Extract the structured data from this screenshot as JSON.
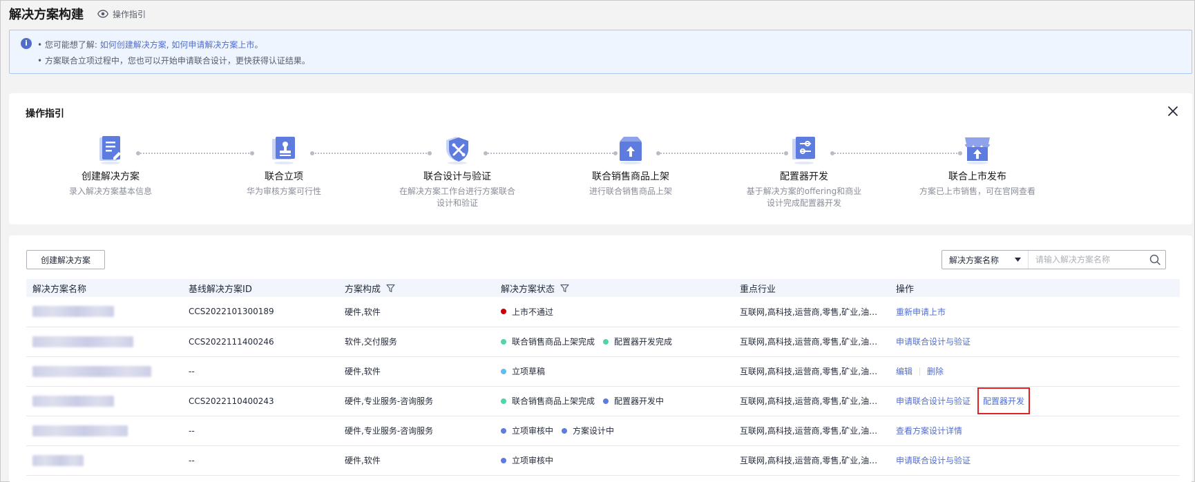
{
  "header": {
    "title": "解决方案构建",
    "guide_link": "操作指引"
  },
  "notice": {
    "line1_prefix": "• 您可能想了解: ",
    "line1_link1": "如何创建解决方案",
    "line1_sep": ", ",
    "line1_link2": "如何申请解决方案上市",
    "line1_suffix": "。",
    "line2": "• 方案联合立项过程中，您也可以开始申请联合设计，更快获得认证结果。"
  },
  "guide": {
    "title": "操作指引",
    "steps": [
      {
        "title": "创建解决方案",
        "desc": "录入解决方案基本信息",
        "icon": "document-edit-icon"
      },
      {
        "title": "联合立项",
        "desc": "华为审核方案可行性",
        "icon": "stamp-icon"
      },
      {
        "title": "联合设计与验证",
        "desc": "在解决方案工作台进行方案联合设计和验证",
        "icon": "shield-tools-icon"
      },
      {
        "title": "联合销售商品上架",
        "desc": "进行联合销售商品上架",
        "icon": "box-upload-icon"
      },
      {
        "title": "配置器开发",
        "desc": "基于解决方案的offering和商业设计完成配置器开发",
        "icon": "config-slider-icon"
      },
      {
        "title": "联合上市发布",
        "desc": "方案已上市销售，可在官网查看",
        "icon": "store-upload-icon"
      }
    ]
  },
  "toolbar": {
    "create_button": "创建解决方案",
    "search_field": "解决方案名称",
    "search_placeholder": "请输入解决方案名称"
  },
  "table": {
    "columns": [
      "解决方案名称",
      "基线解决方案ID",
      "方案构成",
      "解决方案状态",
      "重点行业",
      "操作"
    ],
    "rows": [
      {
        "id": "CCS2022101300189",
        "composition": "硬件,软件",
        "statuses": [
          {
            "label": "上市不通过",
            "color": "#c7000b"
          }
        ],
        "industry": "互联网,高科技,运营商,零售,矿业,油气,智...",
        "actions": [
          "重新申请上市"
        ]
      },
      {
        "id": "CCS2022111400246",
        "composition": "软件,交付服务",
        "statuses": [
          {
            "label": "联合销售商品上架完成",
            "color": "#50d4ab"
          },
          {
            "label": "配置器开发完成",
            "color": "#50d4ab"
          }
        ],
        "industry": "互联网,高科技,运营商,零售,矿业,油气,智...",
        "actions": [
          "申请联合设计与验证"
        ]
      },
      {
        "id": "--",
        "composition": "硬件,软件",
        "statuses": [
          {
            "label": "立项草稿",
            "color": "#62bcf0"
          }
        ],
        "industry": "互联网,高科技,运营商,零售,矿业,油气,智...",
        "actions": [
          "编辑",
          "删除"
        ]
      },
      {
        "id": "CCS2022110400243",
        "composition": "硬件,专业服务-咨询服务",
        "statuses": [
          {
            "label": "联合销售商品上架完成",
            "color": "#50d4ab"
          },
          {
            "label": "配置器开发中",
            "color": "#5e7ce0"
          }
        ],
        "industry": "互联网,高科技,运营商,零售,矿业,油气,智...",
        "actions": [
          "申请联合设计与验证",
          "配置器开发"
        ]
      },
      {
        "id": "--",
        "composition": "硬件,专业服务-咨询服务",
        "statuses": [
          {
            "label": "立项审核中",
            "color": "#5e7ce0"
          },
          {
            "label": "方案设计中",
            "color": "#5e7ce0"
          }
        ],
        "industry": "互联网,高科技,运营商,零售,矿业,油气,智...",
        "actions": [
          "查看方案设计详情"
        ]
      },
      {
        "id": "--",
        "composition": "硬件,软件",
        "statuses": [
          {
            "label": "立项审核中",
            "color": "#5e7ce0"
          }
        ],
        "industry": "互联网,高科技,运营商,零售,矿业,油气,智...",
        "actions": [
          "申请联合设计与验证"
        ]
      }
    ]
  },
  "colors": {
    "link": "#526ecc",
    "accent_icon": "#5e7ce0",
    "highlight_box": "#e02020"
  }
}
